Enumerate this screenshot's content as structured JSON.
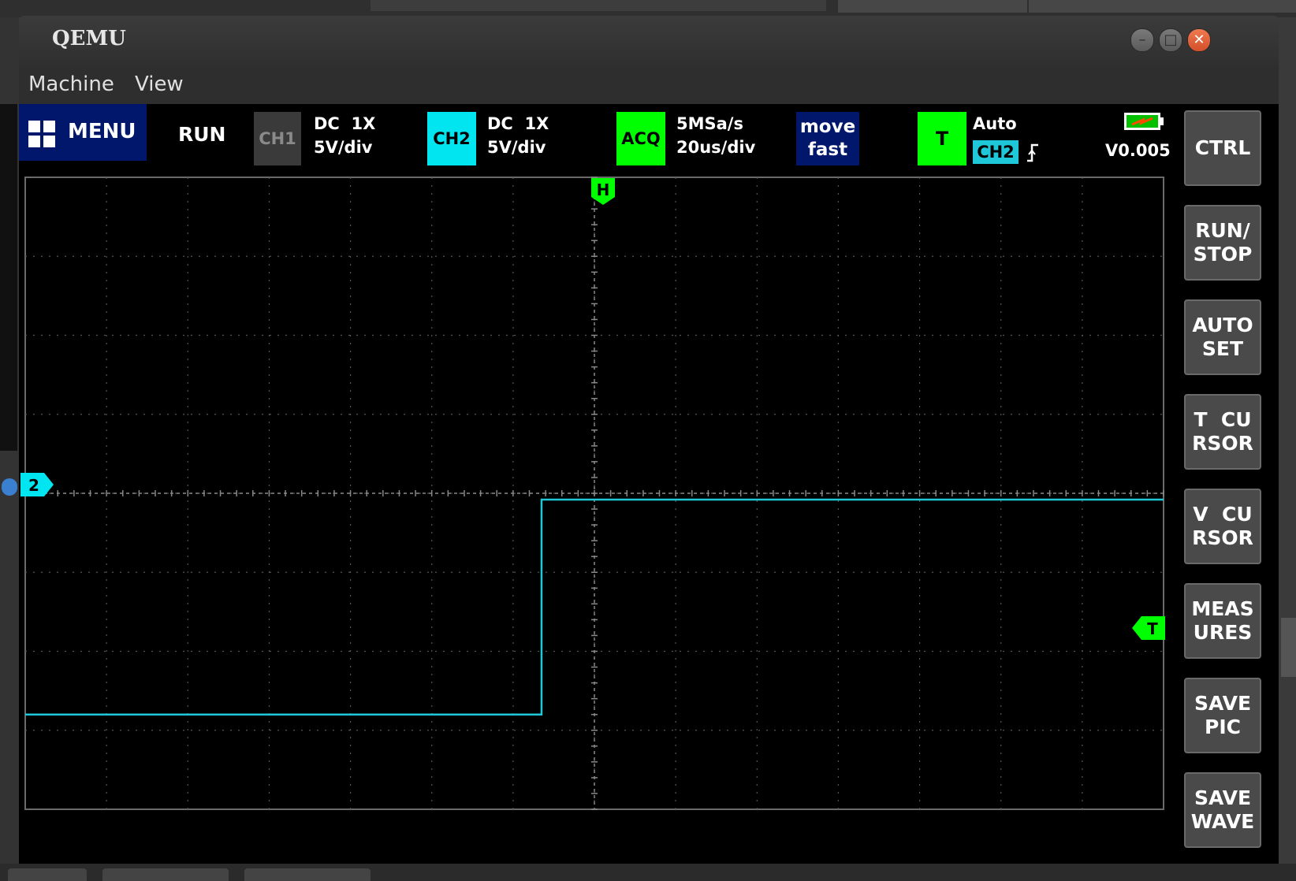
{
  "window": {
    "title": "QEMU",
    "menu": [
      "Machine",
      "View"
    ]
  },
  "scope": {
    "menu_label": "MENU",
    "run_state": "RUN",
    "ch1": {
      "badge": "CH1",
      "coupling": "DC",
      "probe": "1X",
      "scale": "5V/div",
      "color": "#3a3a3a"
    },
    "ch2": {
      "badge": "CH2",
      "coupling": "DC",
      "probe": "1X",
      "scale": "5V/div",
      "color": "#00e5f0"
    },
    "acq": {
      "badge": "ACQ",
      "rate": "5MSa/s",
      "timebase": "20us/div",
      "color": "#00ff00"
    },
    "move": {
      "line1": "move",
      "line2": "fast"
    },
    "trigger": {
      "badge": "T",
      "mode": "Auto",
      "source": "CH2",
      "edge_icon": "rising-edge-icon",
      "level": "V0.005"
    },
    "markers": {
      "horizontal": "H",
      "channel": "2",
      "trigger": "T"
    },
    "side_buttons": [
      "CTRL",
      "RUN/\nSTOP",
      "AUTO\nSET",
      "T  CU\nRSOR",
      "V  CU\nRSOR",
      "MEAS\nURES",
      "SAVE\nPIC",
      "SAVE\nWAVE"
    ]
  },
  "chart_data": {
    "type": "line",
    "series": [
      {
        "color": "#1fc8d8",
        "x": [
          -7,
          -0.65,
          -0.65,
          7
        ],
        "y": [
          -2.8,
          -2.8,
          0,
          0
        ]
      }
    ],
    "xlim": [
      -7,
      7
    ],
    "ylim": [
      -4,
      4
    ],
    "grid": true
  }
}
